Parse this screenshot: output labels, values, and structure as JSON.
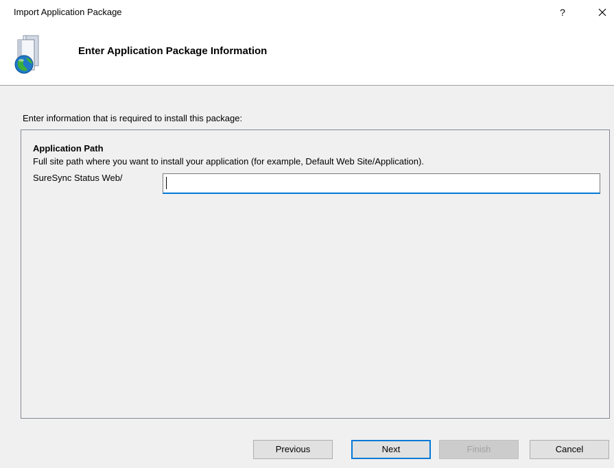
{
  "window": {
    "title": "Import Application Package",
    "help_label": "?"
  },
  "header": {
    "title": "Enter Application Package Information",
    "icon": "package-globe-icon"
  },
  "content": {
    "intro": "Enter information that is required to install this package:",
    "section_title": "Application Path",
    "section_description": "Full site path where you want to install your application (for example, Default Web Site/Application).",
    "path_label": "SureSync Status Web/",
    "path_value": ""
  },
  "footer": {
    "previous_label": "Previous",
    "next_label": "Next",
    "finish_label": "Finish",
    "cancel_label": "Cancel"
  },
  "colors": {
    "accent": "#0078d7",
    "panel_bg": "#f0f0f0",
    "button_bg": "#e1e1e1"
  }
}
